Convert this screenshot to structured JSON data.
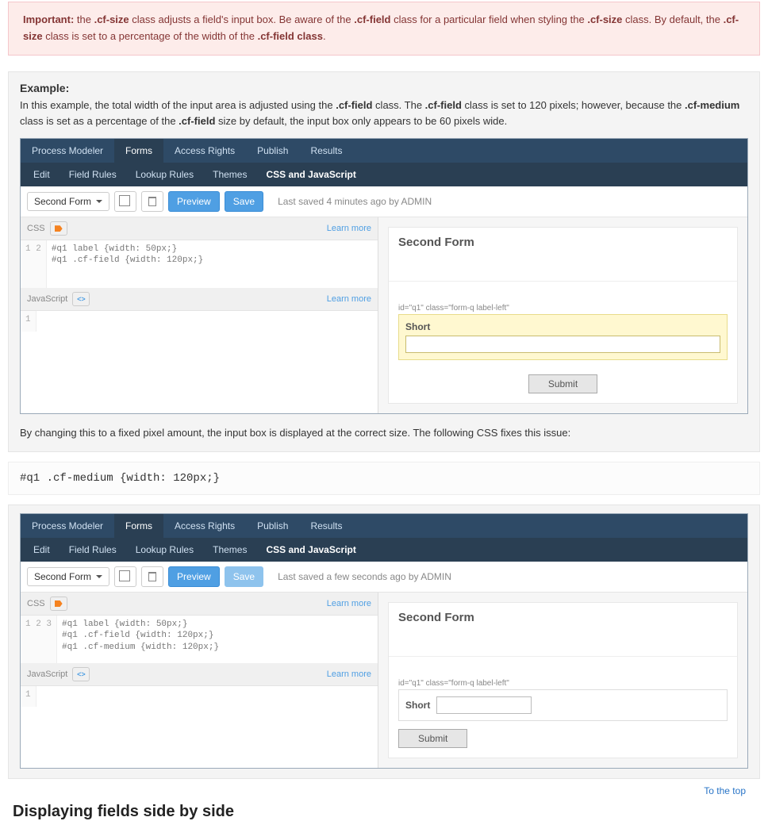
{
  "alert": {
    "lead": "Important:",
    "t1": " the ",
    "c1": ".cf-size",
    "t2": " class adjusts a field's input box. Be aware of the ",
    "c2": ".cf-field",
    "t3": " class for a particular field when styling the ",
    "c3": ".cf-size",
    "t4": " class. By default, the ",
    "c4": ".cf-size",
    "t5": " class is set to a percentage of the width of the ",
    "c5": ".cf-field class",
    "t6": "."
  },
  "example": {
    "head": "Example:",
    "p_t1": "In this example, the total width of the input area is adjusted using the ",
    "p_c1": ".cf-field",
    "p_t2": " class. The ",
    "p_c2": ".cf-field",
    "p_t3": " class is set to 120 pixels; however, because the ",
    "p_c3": ".cf-medium",
    "p_t4": " class is set as a percentage of the ",
    "p_c4": ".cf-field",
    "p_t5": " size by default, the input box only appears to be 60 pixels wide."
  },
  "tabs": {
    "t1": "Process Modeler",
    "t2": "Forms",
    "t3": "Access Rights",
    "t4": "Publish",
    "t5": "Results"
  },
  "subtabs": {
    "s1": "Edit",
    "s2": "Field Rules",
    "s3": "Lookup Rules",
    "s4": "Themes",
    "s5": "CSS and JavaScript"
  },
  "toolbar": {
    "form": "Second Form",
    "preview": "Preview",
    "save": "Save",
    "meta1": "Last saved 4 minutes ago by ADMIN",
    "meta2": "Last saved a few seconds ago by ADMIN"
  },
  "editor": {
    "css_lbl": "CSS",
    "js_lbl": "JavaScript",
    "learn": "Learn more",
    "g1": "1\n2",
    "code1": "#q1 label {width: 50px;}\n#q1 .cf-field {width: 120px;}",
    "g2": "1\n2\n3",
    "code2": "#q1 label {width: 50px;}\n#q1 .cf-field {width: 120px;}\n#q1 .cf-medium {width: 120px;}",
    "gjs": "1"
  },
  "preview": {
    "title": "Second Form",
    "cls": "id=\"q1\" class=\"form-q label-left\"",
    "flabel": "Short",
    "submit": "Submit"
  },
  "middle": {
    "p": "By changing this to a fixed pixel amount, the input box is displayed at the correct size. The following CSS fixes this issue:",
    "code": "#q1 .cf-medium {width: 120px;}"
  },
  "footer": {
    "next": "Displaying fields side by side",
    "totop": "To the top"
  }
}
